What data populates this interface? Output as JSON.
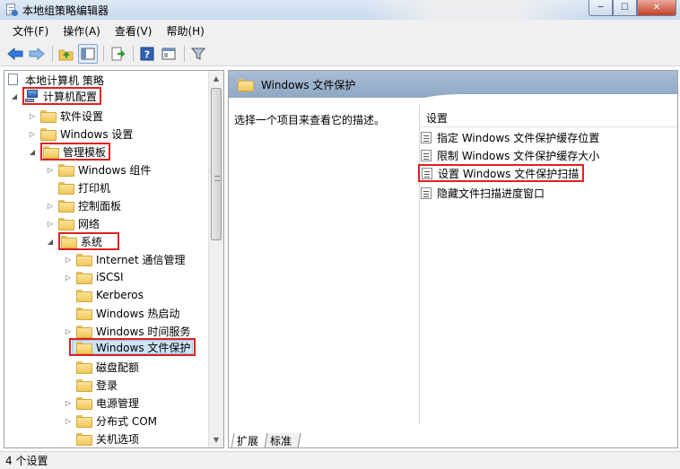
{
  "window": {
    "title": "本地组策略编辑器",
    "min_glyph": "─",
    "max_glyph": "☐",
    "close_glyph": "✕"
  },
  "menu": [
    {
      "label": "文件(F)"
    },
    {
      "label": "操作(A)"
    },
    {
      "label": "查看(V)"
    },
    {
      "label": "帮助(H)"
    }
  ],
  "toolbar": {
    "back_icon": "arrow-left-icon",
    "forward_icon": "arrow-right-icon",
    "buttons": [
      "up-folder-icon",
      "show-hide-tree-icon",
      "export-list-icon",
      "help-icon",
      "properties-icon",
      "filter-icon"
    ]
  },
  "tree": {
    "root": "本地计算机 策略",
    "computer_config": "计算机配置",
    "software_settings": "软件设置",
    "windows_settings": "Windows 设置",
    "admin_templates": "管理模板",
    "windows_components": "Windows 组件",
    "printers": "打印机",
    "control_panel": "控制面板",
    "network": "网络",
    "system": "系统",
    "internet_comm": "Internet 通信管理",
    "iscsi": "iSCSI",
    "kerberos": "Kerberos",
    "windows_hotstart": "Windows 热启动",
    "windows_time": "Windows 时间服务",
    "windows_file_protection": "Windows 文件保护",
    "disk_quota": "磁盘配额",
    "logon": "登录",
    "power_mgmt": "电源管理",
    "distributed_com": "分布式 COM",
    "shutdown_options": "关机选项"
  },
  "right_pane": {
    "header_title": "Windows 文件保护",
    "description": "选择一个项目来查看它的描述。",
    "settings_header": "设置",
    "settings": [
      {
        "label": "指定 Windows 文件保护缓存位置"
      },
      {
        "label": "限制 Windows 文件保护缓存大小"
      },
      {
        "label": "设置 Windows 文件保护扫描"
      },
      {
        "label": "隐藏文件扫描进度窗口"
      }
    ],
    "tabs": [
      {
        "label": "扩展"
      },
      {
        "label": "标准"
      }
    ]
  },
  "status": {
    "text": "4 个设置"
  },
  "colors": {
    "highlight_red": "#e02020",
    "header_blue": "#9fb6d0",
    "folder_yellow": "#f1c85a"
  }
}
